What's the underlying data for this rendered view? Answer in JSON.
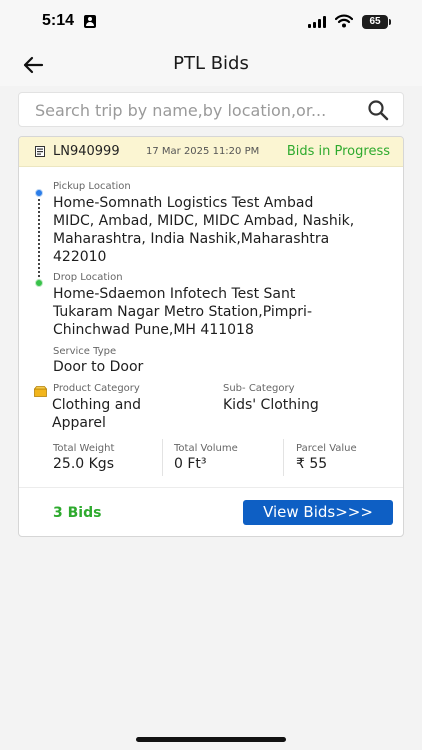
{
  "status_bar": {
    "time": "5:14",
    "battery": "65"
  },
  "header": {
    "title": "PTL Bids"
  },
  "search": {
    "placeholder": "Search trip by name,by location,or..."
  },
  "trip": {
    "id": "LN940999",
    "date": "17 Mar 2025 11:20 PM",
    "status": "Bids in Progress",
    "pickup_label": "Pickup Location",
    "pickup_lines": [
      "Home-Somnath Logistics Test Ambad",
      "MIDC, Ambad, MIDC, MIDC Ambad, Nashik,",
      "Maharashtra, India Nashik,Maharashtra",
      "422010"
    ],
    "drop_label": "Drop Location",
    "drop_lines": [
      "Home-Sdaemon Infotech  Test Sant",
      "Tukaram Nagar Metro Station,Pimpri-",
      "Chinchwad Pune,MH 411018"
    ],
    "service_type_label": "Service Type",
    "service_type": "Door to Door",
    "product_category_label": "Product Category",
    "product_category_lines": [
      "Clothing and",
      "Apparel"
    ],
    "sub_category_label": "Sub- Category",
    "sub_category": "Kids' Clothing",
    "total_weight_label": "Total Weight",
    "total_weight": "25.0 Kgs",
    "total_volume_label": "Total Volume",
    "total_volume": "0 Ft³",
    "parcel_value_label": "Parcel Value",
    "parcel_value": "₹ 55",
    "bids_count": "3 Bids",
    "view_bids_label": "View Bids>>>"
  },
  "colors": {
    "header_band": "#fbf5d2",
    "status_green": "#2eaa2e",
    "button_blue": "#0e5fc4",
    "pickup_dot": "#2b7de9",
    "drop_dot": "#38c24a"
  },
  "icons": [
    "id-card-icon",
    "signal-icon",
    "wifi-icon",
    "battery-icon",
    "back-arrow-icon",
    "search-icon",
    "document-icon",
    "box-icon"
  ]
}
